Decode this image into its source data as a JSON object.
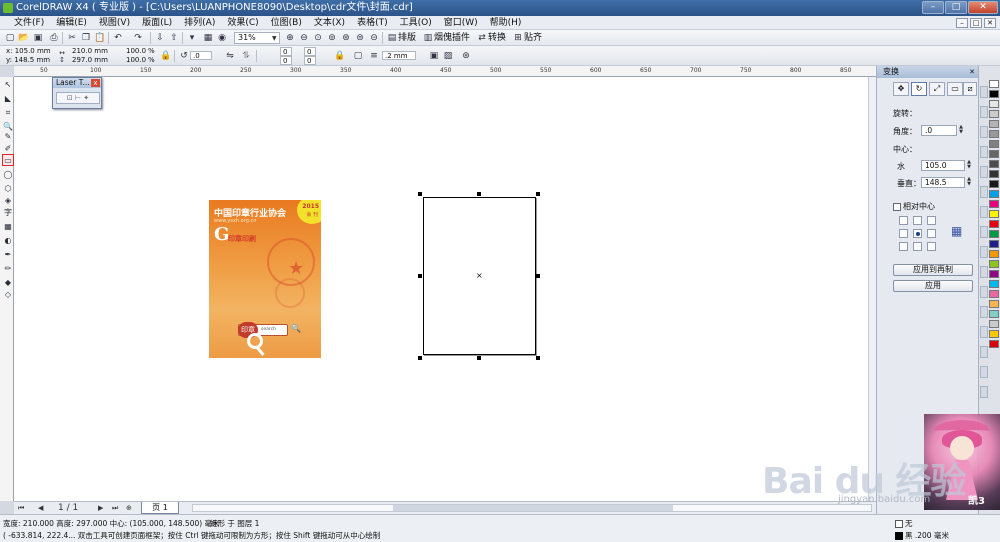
{
  "window": {
    "title": "CorelDRAW X4 ( 专业版 ) - [C:\\Users\\LUANPHONE8090\\Desktop\\cdr文件\\封面.cdr]",
    "controls": [
      "–",
      "□",
      "✕"
    ]
  },
  "menu": [
    "文件(F)",
    "编辑(E)",
    "视图(V)",
    "版面(L)",
    "排列(A)",
    "效果(C)",
    "位图(B)",
    "文本(X)",
    "表格(T)",
    "工具(O)",
    "窗口(W)",
    "帮助(H)"
  ],
  "mdi_controls": [
    "–",
    "□",
    "✕"
  ],
  "standard_toolbar": {
    "zoom": "31%",
    "snap_label": "排版",
    "plugin_label": "烟傀插件",
    "convert_label": "转换",
    "align_label": "贴齐"
  },
  "property_bar": {
    "x": "x: 105.0 mm",
    "y": "y: 148.5 mm",
    "width": "210.0 mm",
    "height": "297.0 mm",
    "scale_w": "100.0",
    "scale_h": "100.0",
    "pct": "%",
    "rotation": ".0",
    "corner_top": "0",
    "corner_top_r": "0",
    "corner_bot": "0",
    "corner_bot_r": "0",
    "outline_width": ".2 mm"
  },
  "ruler": {
    "h_ticks": [
      "50",
      "100",
      "150",
      "200",
      "250",
      "300",
      "350",
      "400",
      "450",
      "500",
      "550",
      "600",
      "650",
      "700",
      "750",
      "800",
      "850"
    ],
    "mm": "毫米"
  },
  "laser_panel": {
    "title": "Laser T...",
    "close": "x"
  },
  "cover": {
    "title": "中国印章行业协会",
    "url": "www.ysxh.org.cn",
    "badge_year": "2015",
    "badge_text": "会 刊",
    "g_letter": "G",
    "g_sub": "印章印刷",
    "seal_text": "印章",
    "search_text": "search"
  },
  "page_nav": {
    "first": "⏮",
    "prev": "◀",
    "counter": "1 / 1",
    "next": "▶",
    "last": "⏭",
    "add": "⊕",
    "tab_label": "页 1"
  },
  "status": {
    "line1": "宽度: 210.000  高度: 297.000  中心: (105.000, 148.500)  毫米",
    "line1b": "矩形 于 图层 1",
    "line2": "( -633.814, 222.4... 双击工具可创建页面框架；按住 Ctrl 键拖动可限制为方形；按住 Shift 键拖动可从中心绘制",
    "fill": "无",
    "outline": "黑  .200 毫米"
  },
  "docker": {
    "title": "变换",
    "rotation_label": "旋转：",
    "angle_label": "角度：",
    "angle_value": ".0",
    "center_label": "中心：",
    "h_label": "水",
    "h_value": "105.0",
    "v_label": "垂直：",
    "v_value": "148.5",
    "relative_label": "相对中心",
    "apply_copy": "应用到再制",
    "apply": "应用"
  },
  "palette_colors": [
    "#ffffff",
    "#000000",
    "#e6e6e6",
    "#cccccc",
    "#b3b3b3",
    "#999999",
    "#808080",
    "#666666",
    "#4d4d4d",
    "#333333",
    "#1a1a1a",
    "#00a0e9",
    "#e4007f",
    "#fff100",
    "#e60012",
    "#009944",
    "#1d2088",
    "#f39800",
    "#8fc31f",
    "#920783",
    "#00b7ee",
    "#ea68a2",
    "#f8b551",
    "#84ccc9",
    "#c9caca",
    "#fcc800",
    "#d7000f"
  ],
  "watermark": {
    "brand": "Bai du 经验",
    "url": "jingyan.baidu.com",
    "mascot_logo": "凯3"
  }
}
